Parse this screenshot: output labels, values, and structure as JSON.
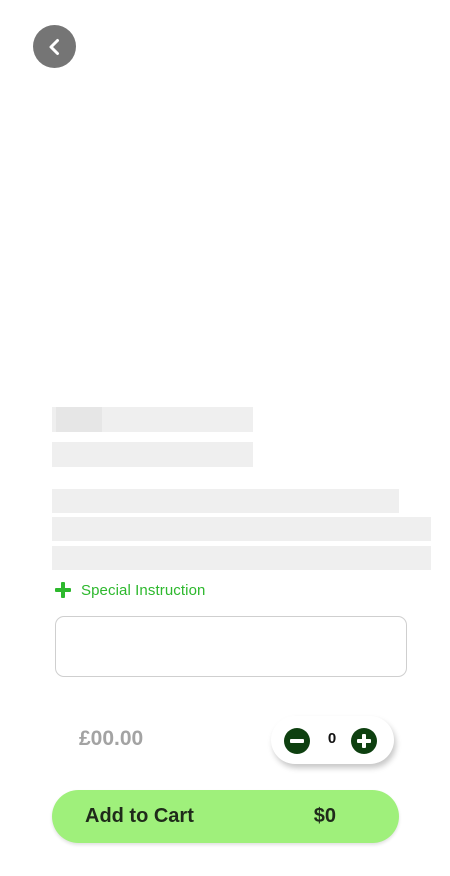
{
  "header": {
    "back_icon": "chevron-left-icon"
  },
  "product": {
    "loading": true
  },
  "special_instruction": {
    "label": "Special Instruction",
    "icon": "plus-icon",
    "value": "",
    "placeholder": ""
  },
  "price": {
    "value": "£00.00"
  },
  "quantity": {
    "value": "0",
    "decrement_icon": "minus-icon",
    "increment_icon": "plus-icon"
  },
  "cart_button": {
    "label": "Add to Cart",
    "total": "$0"
  },
  "colors": {
    "accent_green": "#2db82d",
    "cart_button_bg": "#9ff07b",
    "stepper_button": "#0e4010",
    "back_button_bg": "#757575",
    "skeleton": "#efefef"
  }
}
